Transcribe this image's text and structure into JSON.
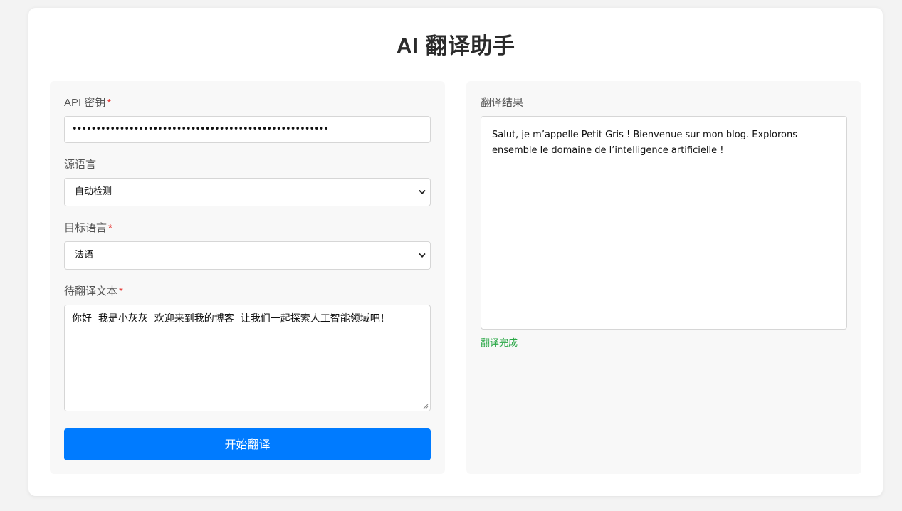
{
  "app": {
    "title": "AI 翻译助手"
  },
  "form": {
    "api_key": {
      "label": "API 密钥",
      "required_mark": "*",
      "masked_value": "••••••••••••••••••••••••••••••••••••••••••••••••••••••"
    },
    "source_language": {
      "label": "源语言",
      "selected": "自动检测"
    },
    "target_language": {
      "label": "目标语言",
      "required_mark": "*",
      "selected": "法语"
    },
    "source_text": {
      "label": "待翻译文本",
      "required_mark": "*",
      "value": "你好  我是小灰灰  欢迎来到我的博客  让我们一起探索人工智能领域吧！"
    },
    "submit_label": "开始翻译"
  },
  "result": {
    "label": "翻译结果",
    "text": "Salut, je m’appelle Petit Gris ! Bienvenue sur mon blog. Explorons ensemble le domaine de l’intelligence artificielle !",
    "status": "翻译完成",
    "status_color": "#28a745"
  },
  "colors": {
    "accent": "#007bff",
    "required": "#e53935",
    "background": "#f3f3f3",
    "panel": "#f8f8f8"
  },
  "icons": {
    "select_arrow": "chevron-down-icon",
    "textarea_resize": "resize-grip-icon"
  }
}
